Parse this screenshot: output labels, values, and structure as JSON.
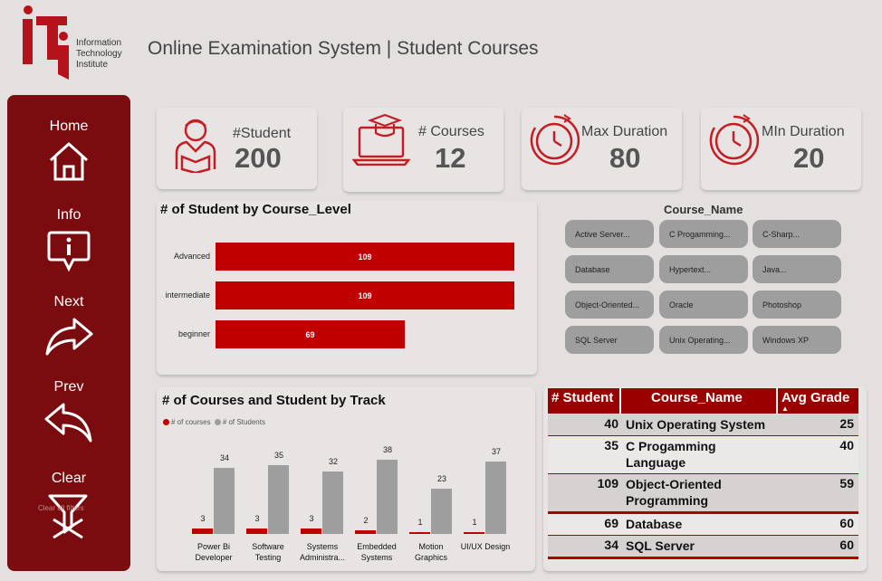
{
  "header": {
    "logo_name": "iti-logo",
    "logo_text": [
      "Information",
      "Technology",
      "Institute"
    ],
    "title": "Online Examination System | Student Courses"
  },
  "sidebar": {
    "items": [
      {
        "label": "Home",
        "icon": "home-icon"
      },
      {
        "label": "Info",
        "icon": "info-icon"
      },
      {
        "label": "Next",
        "icon": "forward-arrow-icon"
      },
      {
        "label": "Prev",
        "icon": "back-arrow-icon"
      },
      {
        "label": "Clear",
        "icon": "clear-filters-icon",
        "sub": "Clear all filters"
      }
    ]
  },
  "kpis": [
    {
      "label": "#Student",
      "value": "200",
      "icon": "student-icon"
    },
    {
      "label": "# Courses",
      "value": "12",
      "icon": "laptop-graduation-icon"
    },
    {
      "label": "Max Duration",
      "value": "80",
      "icon": "stopwatch-icon"
    },
    {
      "label": "MIn Duration",
      "value": "20",
      "icon": "stopwatch-icon"
    }
  ],
  "level_chart": {
    "title": "# of Student by Course_Level"
  },
  "slicer": {
    "title": "Course_Name",
    "items": [
      "Active Server...",
      "C Progamming...",
      "C-Sharp...",
      "Database",
      "Hypertext...",
      "Java...",
      "Object-Oriented...",
      "Oracle",
      "Photoshop",
      "SQL Server",
      "Unix Operating...",
      "Windows XP"
    ]
  },
  "track_chart": {
    "title": "# of Courses and Student by Track",
    "legend": [
      "# of courses",
      "# of Students"
    ]
  },
  "table": {
    "headers": [
      "# Student",
      "Course_Name",
      "Avg Grade"
    ],
    "rows": [
      {
        "students": "40",
        "course": "Unix Operating System",
        "grade": "25"
      },
      {
        "students": "35",
        "course": "C Progamming Language",
        "grade": "40"
      },
      {
        "students": "109",
        "course": "Object-Oriented Programming",
        "grade": "59"
      },
      {
        "students": "69",
        "course": "Database",
        "grade": "60"
      },
      {
        "students": "34",
        "course": "SQL Server",
        "grade": "60"
      }
    ]
  },
  "colors": {
    "accent": "#c00000",
    "sidebar": "#7a0c0f",
    "grey_series": "#9e9e9e"
  },
  "chart_data": [
    {
      "type": "bar",
      "orientation": "horizontal",
      "title": "# of Student by Course_Level",
      "categories": [
        "Advanced",
        "intermediate",
        "beginner"
      ],
      "values": [
        109,
        109,
        69
      ],
      "xlim": [
        0,
        109
      ]
    },
    {
      "type": "bar",
      "title": "# of Courses and Student by Track",
      "categories": [
        "Power Bi Developer",
        "Software Testing",
        "Systems Administra...",
        "Embedded Systems",
        "Motion Graphics",
        "UI/UX Design"
      ],
      "series": [
        {
          "name": "# of courses",
          "values": [
            3,
            3,
            3,
            2,
            1,
            1
          ],
          "color": "#c00000"
        },
        {
          "name": "# of Students",
          "values": [
            34,
            35,
            32,
            38,
            23,
            37
          ],
          "color": "#9e9e9e"
        }
      ],
      "legend": "top-left",
      "ylim": [
        0,
        38
      ]
    }
  ]
}
